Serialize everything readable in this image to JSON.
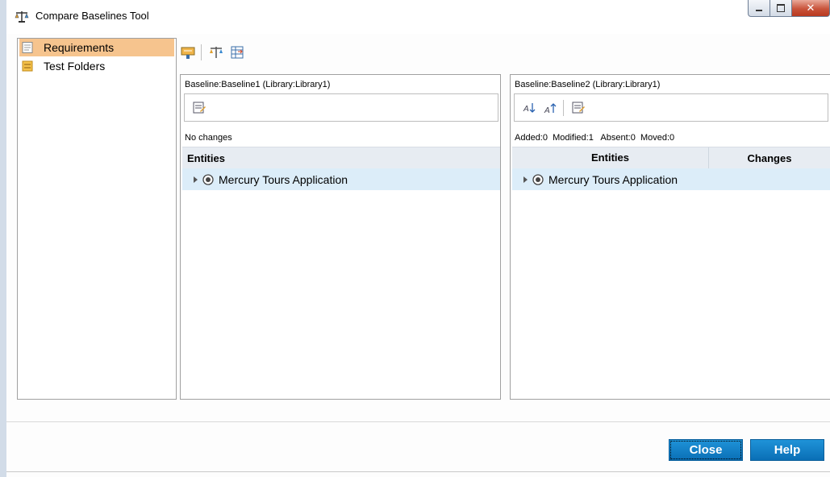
{
  "window": {
    "title": "Compare Baselines Tool"
  },
  "sidebar": {
    "items": [
      {
        "label": "Requirements",
        "selected": true,
        "icon": "requirements-icon"
      },
      {
        "label": "Test Folders",
        "selected": false,
        "icon": "test-folders-icon"
      }
    ]
  },
  "toolbar": {
    "icons": [
      "compare-settings-icon",
      "compare-icon",
      "export-icon"
    ]
  },
  "left_pane": {
    "title": "Baseline:Baseline1 (Library:Library1)",
    "status": "No changes",
    "columns": [
      "Entities"
    ],
    "rows": [
      {
        "entity": "Mercury Tours Application"
      }
    ]
  },
  "right_pane": {
    "title": "Baseline:Baseline2 (Library:Library1)",
    "status": "Added:0  Modified:1   Absent:0  Moved:0",
    "columns": [
      "Entities",
      "Changes"
    ],
    "rows": [
      {
        "entity": "Mercury Tours Application",
        "changes": ""
      }
    ]
  },
  "buttons": {
    "close": "Close",
    "help": "Help"
  },
  "colors": {
    "selection": "#f6c48e",
    "row_highlight": "#dcedf9",
    "button": "#1f93d8"
  }
}
